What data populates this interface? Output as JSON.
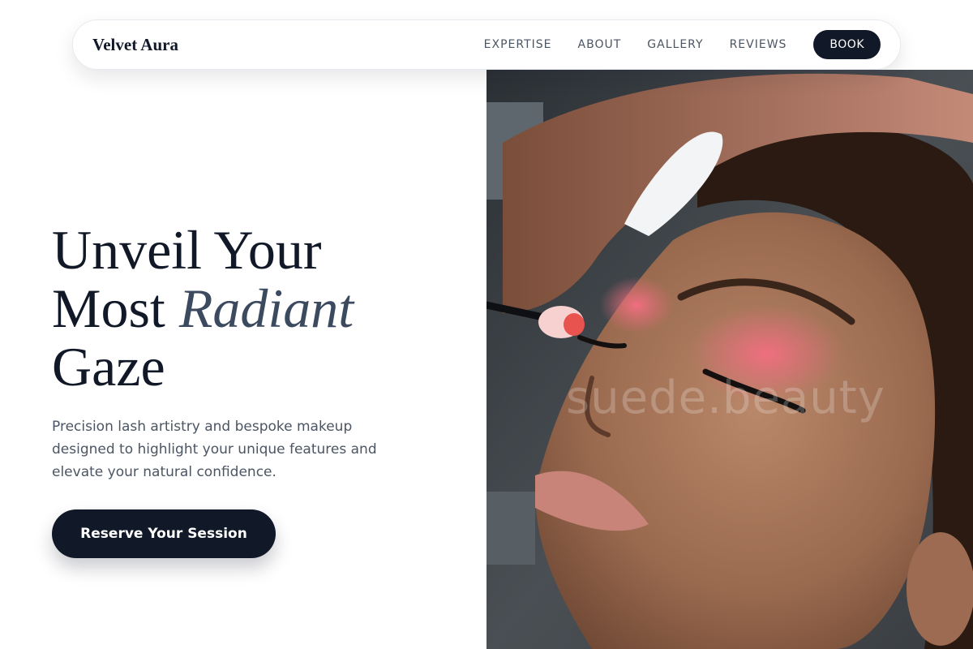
{
  "nav": {
    "brand": "Velvet Aura",
    "links": [
      "EXPERTISE",
      "ABOUT",
      "GALLERY",
      "REVIEWS"
    ],
    "book_label": "BOOK"
  },
  "hero": {
    "title_line1": "Unveil Your",
    "title_line2_prefix": "Most ",
    "title_line2_italic": "Radiant",
    "title_line3": "Gaze",
    "description": "Precision lash artistry and bespoke makeup designed to highlight your unique features and elevate your natural confidence.",
    "cta_label": "Reserve Your Session",
    "image_watermark": "suede.beauty",
    "image_subject": "makeup-artist-applying-pink-eyeshadow-photo"
  },
  "colors": {
    "primary": "#111827",
    "accent_text": "#3c4a5f",
    "body_text": "#4b5563",
    "eyeshadow": "#e56b7a"
  }
}
